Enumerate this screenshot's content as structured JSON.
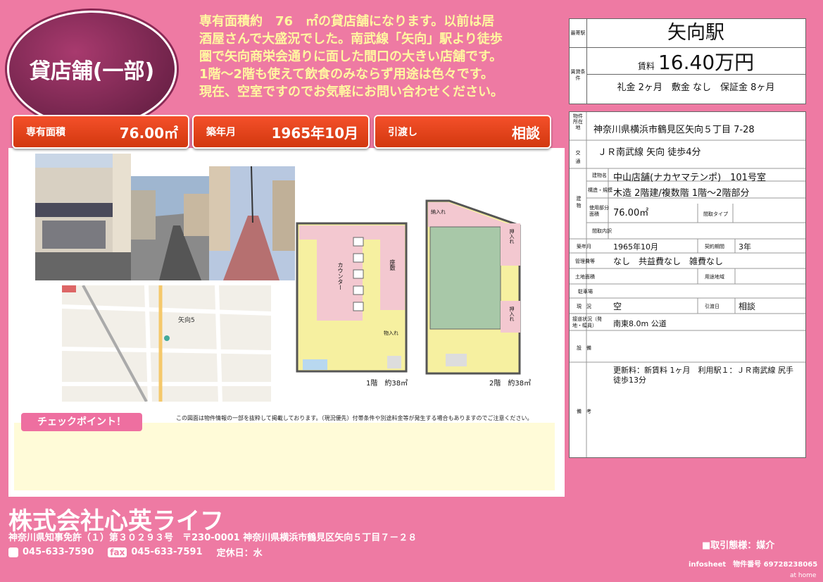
{
  "badge": {
    "text": "貸店舗(一部)"
  },
  "description": [
    "専有面積約　76　㎡の貸店舗になります。以前は居",
    "酒屋さんで大盛況でした。南武線「矢向」駅より徒歩",
    "圏で矢向商栄会通りに面した間口の大きい店舗です。",
    "1階～2階も使えて飲食のみならず用途は色々です。",
    "現在、空室ですのでお気軽にお問い合わせください。"
  ],
  "pills": [
    {
      "label": "専有面積",
      "value": "76.00㎡"
    },
    {
      "label": "築年月",
      "value": "1965年10月"
    },
    {
      "label": "引渡し",
      "value": "相談"
    }
  ],
  "floorplan": {
    "floor1_label": "1階　約38㎡",
    "floor2_label": "2階　約38㎡",
    "counter": "カウンター",
    "zashiki": "座敷",
    "storage": "物入れ",
    "oshiire": "押入れ",
    "storage2": "納入れ"
  },
  "map": {
    "station_label": "矢向5"
  },
  "notice": "この図面は物件情報の一部を抜粋して掲載しております。（現況優先）付帯条件や別途料金等が発生する場合もありますのでご注意ください。",
  "checkpoint": {
    "label": "チェックポイント！"
  },
  "info": {
    "station_lab": "最寄駅",
    "station": "矢向駅",
    "rent_lab": "賃貸条件",
    "rent_prefix": "賃料",
    "rent": "16.40万円",
    "fees": "礼金 2ヶ月　敷金 なし　保証金 8ヶ月",
    "addr_lab": "物件所在地",
    "address": "神奈川県横浜市鶴見区矢向５丁目 7-28",
    "traffic_lab": "交通",
    "traffic": "ＪＲ南武線 矢向 徒歩4分",
    "building_lab": "建物",
    "name_lab": "建物名",
    "name": "中山店舗(ナカヤマテンポ)　101号室",
    "struct_lab": "構造・規模",
    "struct": "木造 2階建/複数階 1階～2階部分",
    "area_lab": "使用部分面積",
    "area": "76.00㎡",
    "direction_lab": "間取タイプ",
    "layout_lab": "間取内訳",
    "built_lab": "築年月",
    "built": "1965年10月",
    "contract_lab": "契約期間",
    "contract": "3年",
    "mgmt_lab": "管理費等",
    "mgmt": "なし　共益費なし　雑費なし",
    "land_lab": "土地面積",
    "use_lab": "用途地域",
    "parking_lab": "駐車場",
    "status_lab": "現　況",
    "status": "空",
    "handover_lab": "引渡日",
    "handover": "相談",
    "road_lab": "接道状況（発地・幅員）",
    "road": "南東8.0m 公道",
    "facilities_lab": "設　備",
    "remarks_lab": "備　考",
    "remarks": "更新料：新賃料 1ヶ月　利用駅１：ＪＲ南武線 尻手 徒歩13分"
  },
  "footer": {
    "company": "株式会社心英ライフ",
    "license": "神奈川県知事免許（１）第３０２９３号　〒230-0001 神奈川県横浜市鶴見区矢向５丁目７－２８",
    "tel": "045-633-7590",
    "fax_label": "fax",
    "fax": "045-633-7591",
    "closed": "定休日：水",
    "dealing": "■取引態様：媒介",
    "infosheet": "infosheet　物件番号 69728238065",
    "athome": "at home"
  }
}
